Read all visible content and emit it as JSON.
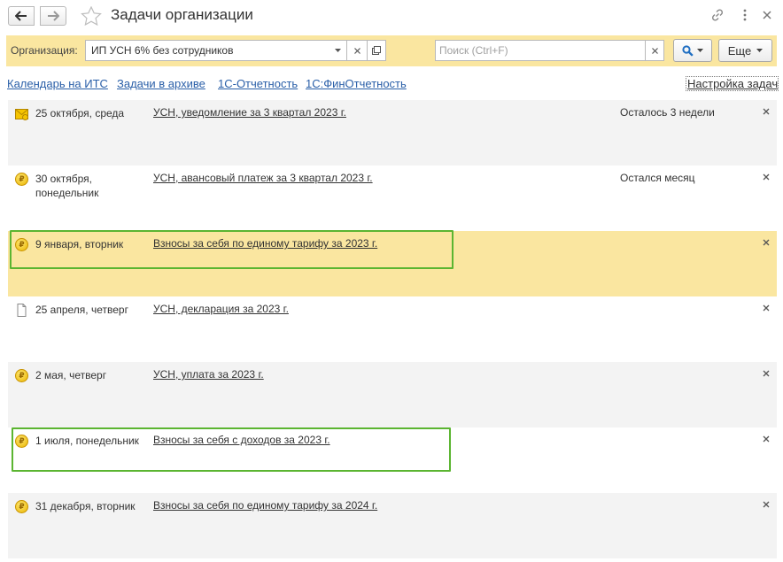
{
  "window": {
    "title": "Задачи организации",
    "back_icon": "arrow-left-icon",
    "forward_icon": "arrow-right-icon",
    "favorite_icon": "star-icon",
    "link_icon": "link-icon",
    "menu_icon": "more-vertical-icon",
    "close_icon": "close-icon"
  },
  "filter": {
    "org_label": "Организация:",
    "org_value": "ИП УСН 6% без сотрудников",
    "search_placeholder": "Поиск (Ctrl+F)",
    "more_label": "Еще",
    "accent_color": "#fae6a0"
  },
  "links": {
    "calendar": "Календарь на ИТС",
    "archive": "Задачи в архиве",
    "reporting": "1С-Отчетность",
    "fin_reporting": "1С:ФинОтчетность",
    "settings": "Настройка задач"
  },
  "tasks": [
    {
      "icon": "envelope-icon",
      "date": "25 октября, среда",
      "name": "УСН, уведомление за 3 квартал 2023 г.",
      "remaining": "Осталось 3 недели",
      "highlighted": false,
      "selected": false
    },
    {
      "icon": "ruble-coin-icon",
      "date": "30 октября, понедельник",
      "name": "УСН, авансовый платеж за 3 квартал 2023 г.",
      "remaining": "Остался месяц",
      "highlighted": false,
      "selected": false
    },
    {
      "icon": "ruble-coin-icon",
      "date": "9 января, вторник",
      "name": "Взносы за себя по единому тарифу за 2023 г.",
      "remaining": "",
      "highlighted": true,
      "selected": true
    },
    {
      "icon": "document-icon",
      "date": "25 апреля, четверг",
      "name": "УСН, декларация за 2023 г.",
      "remaining": "",
      "highlighted": false,
      "selected": false
    },
    {
      "icon": "ruble-coin-icon",
      "date": "2 мая, четверг",
      "name": "УСН, уплата за 2023 г.",
      "remaining": "",
      "highlighted": false,
      "selected": false
    },
    {
      "icon": "ruble-coin-icon",
      "date": "1 июля, понедельник",
      "name": "Взносы за себя с доходов за 2023 г.",
      "remaining": "",
      "highlighted": true,
      "selected": false
    },
    {
      "icon": "ruble-coin-icon",
      "date": "31 декабря, вторник",
      "name": "Взносы за себя по единому тарифу за 2024 г.",
      "remaining": "",
      "highlighted": false,
      "selected": false
    }
  ],
  "colors": {
    "highlight_border": "#5bb531",
    "link": "#2a5fa8",
    "selected_row": "#fae6a0"
  }
}
